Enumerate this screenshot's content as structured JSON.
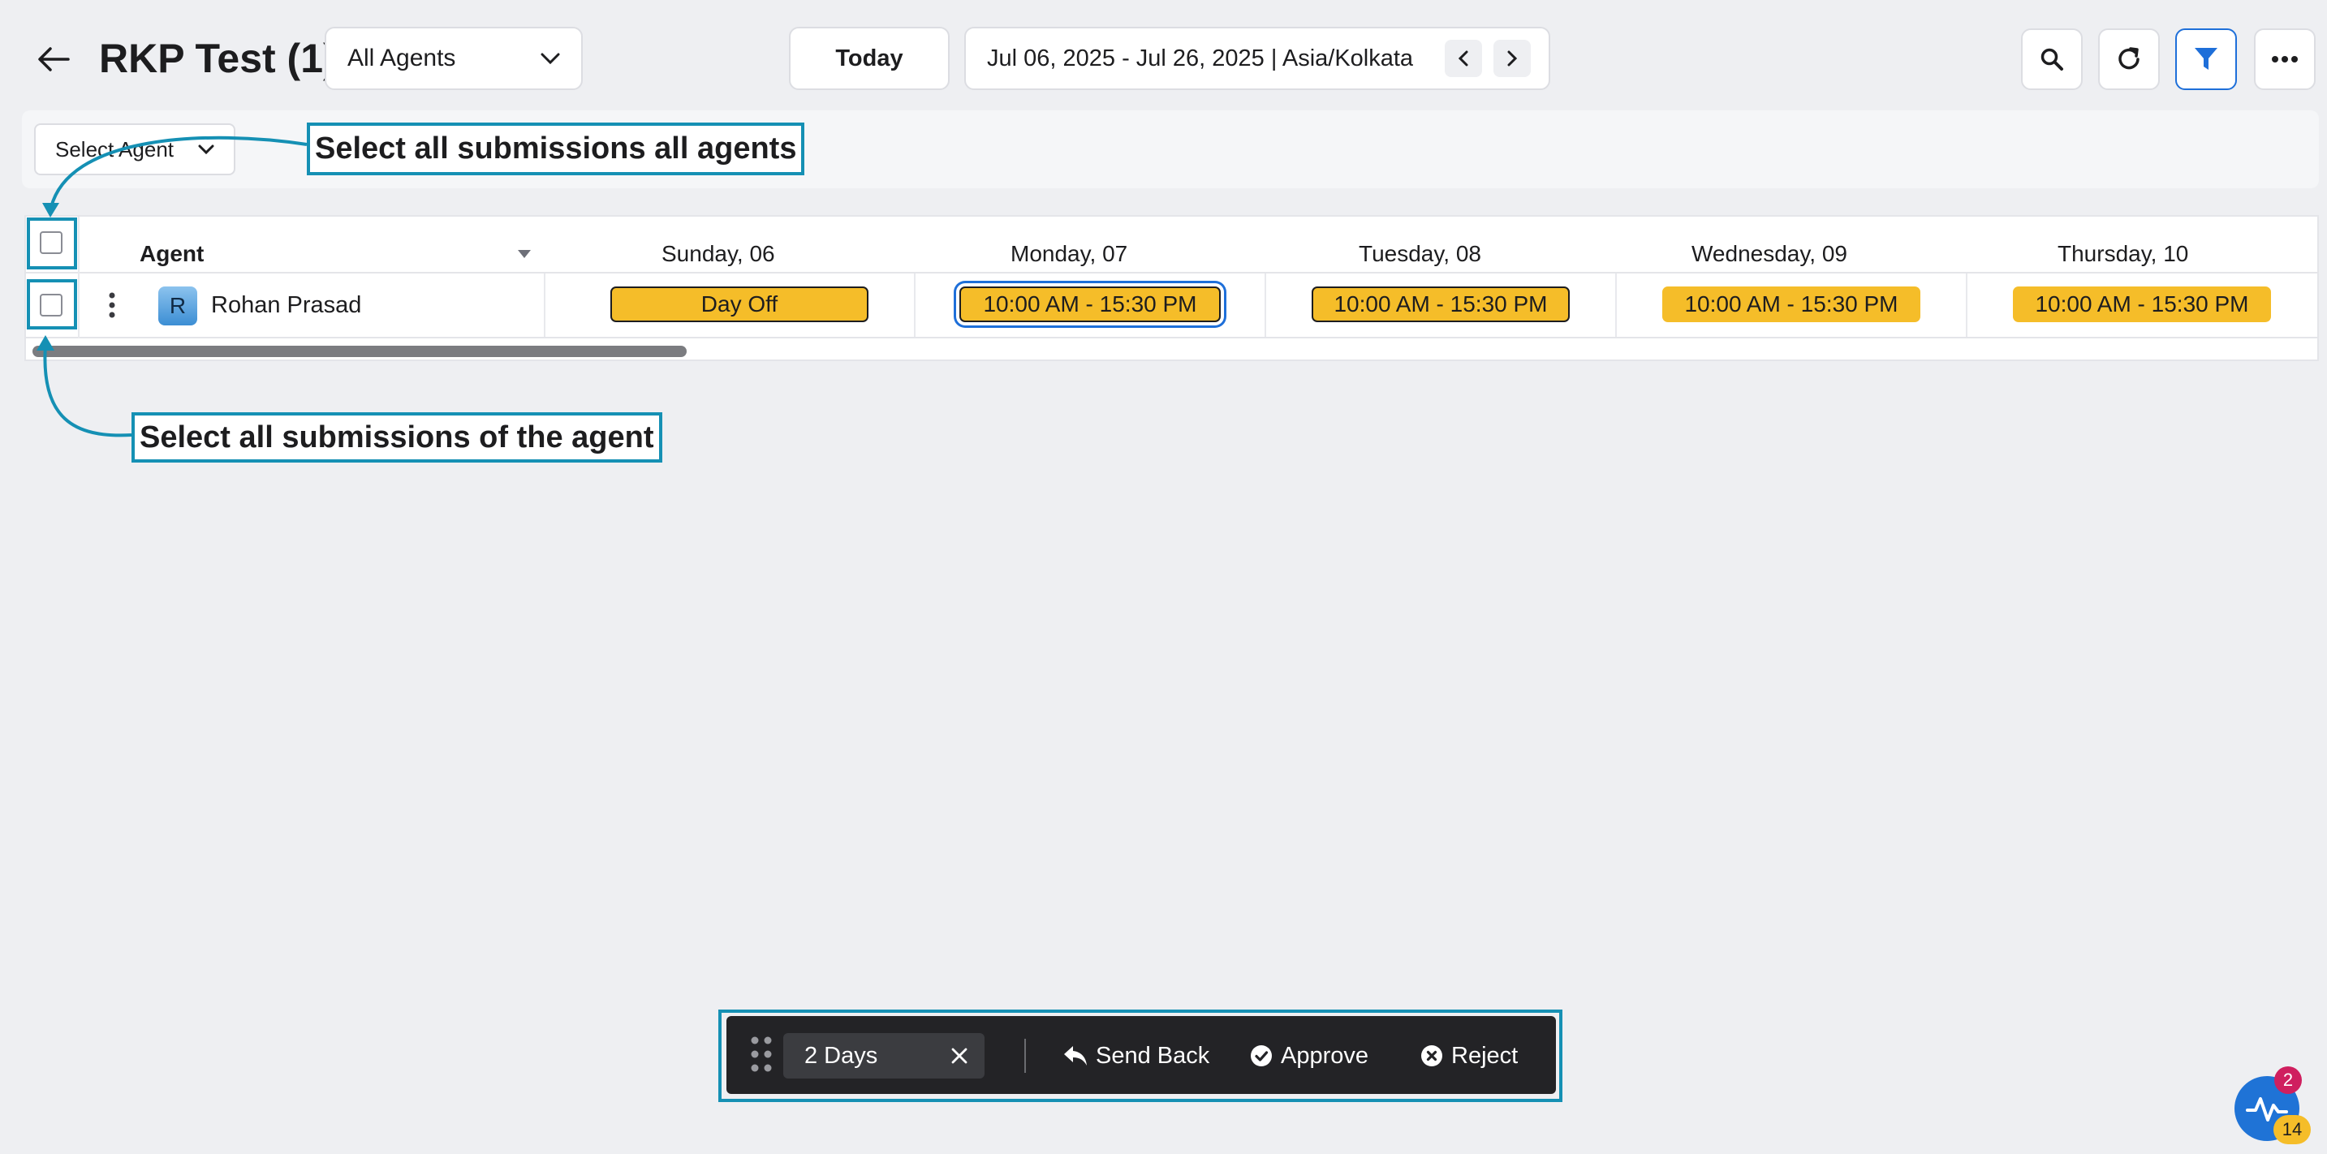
{
  "header": {
    "title": "RKP Test (1)",
    "agent_filter": "All Agents",
    "today_label": "Today",
    "date_range": "Jul 06, 2025 - Jul 26, 2025 | Asia/Kolkata"
  },
  "filter_bar": {
    "select_agent_label": "Select Agent"
  },
  "table": {
    "agent_column": "Agent",
    "days": [
      "Sunday, 06",
      "Monday, 07",
      "Tuesday, 08",
      "Wednesday, 09",
      "Thursday, 10"
    ],
    "rows": [
      {
        "avatar_initial": "R",
        "agent_name": "Rohan Prasad",
        "shifts": [
          "Day Off",
          "10:00 AM - 15:30 PM",
          "10:00 AM - 15:30 PM",
          "10:00 AM - 15:30 PM",
          "10:00 AM - 15:30 PM"
        ]
      }
    ]
  },
  "annotations": {
    "select_all_agents": "Select all submissions all agents",
    "select_agent_row": "Select all submissions of the agent"
  },
  "action_bar": {
    "selection_chip": "2 Days",
    "send_back": "Send Back",
    "approve": "Approve",
    "reject": "Reject"
  },
  "help_widget": {
    "badge_top": "2",
    "badge_bottom": "14"
  },
  "colors": {
    "shift": "#f5bd29",
    "accent": "#1e6fd9",
    "annotation": "#1590b4"
  }
}
